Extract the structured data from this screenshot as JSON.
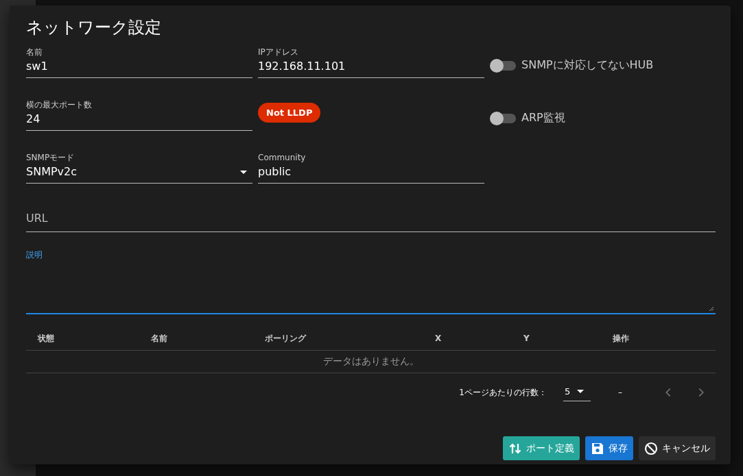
{
  "dialog": {
    "title": "ネットワーク設定",
    "rows": [
      [
        {
          "kind": "text",
          "label": "名前",
          "value": "sw1"
        },
        {
          "kind": "text",
          "label": "IPアドレス",
          "value": "192.168.11.101"
        },
        {
          "kind": "switch",
          "label": "SNMPに対応してないHUB",
          "on": false
        }
      ],
      [
        {
          "kind": "text",
          "label": "横の最大ポート数",
          "value": "24"
        },
        {
          "kind": "chip",
          "text": "Not LLDP"
        },
        {
          "kind": "switch",
          "label": "ARP監視",
          "on": false
        }
      ],
      [
        {
          "kind": "select",
          "label": "SNMPモード",
          "value": "SNMPv2c"
        },
        {
          "kind": "text",
          "label": "Community",
          "value": "public"
        }
      ]
    ],
    "url": {
      "placeholder": "URL"
    },
    "description": {
      "label": "説明",
      "focused": true
    },
    "table": {
      "columns": [
        "状態",
        "名前",
        "ポーリング",
        "X",
        "Y",
        "操作"
      ],
      "empty": "データはありません。"
    },
    "pagination": {
      "rows_label": "1ページあたりの行数：",
      "rows_per_page": "5",
      "range": "–"
    },
    "buttons": [
      {
        "kind": "ports",
        "label": "ポート定義"
      },
      {
        "kind": "save",
        "label": "保存"
      },
      {
        "kind": "cancel",
        "label": "キャンセル"
      }
    ]
  }
}
